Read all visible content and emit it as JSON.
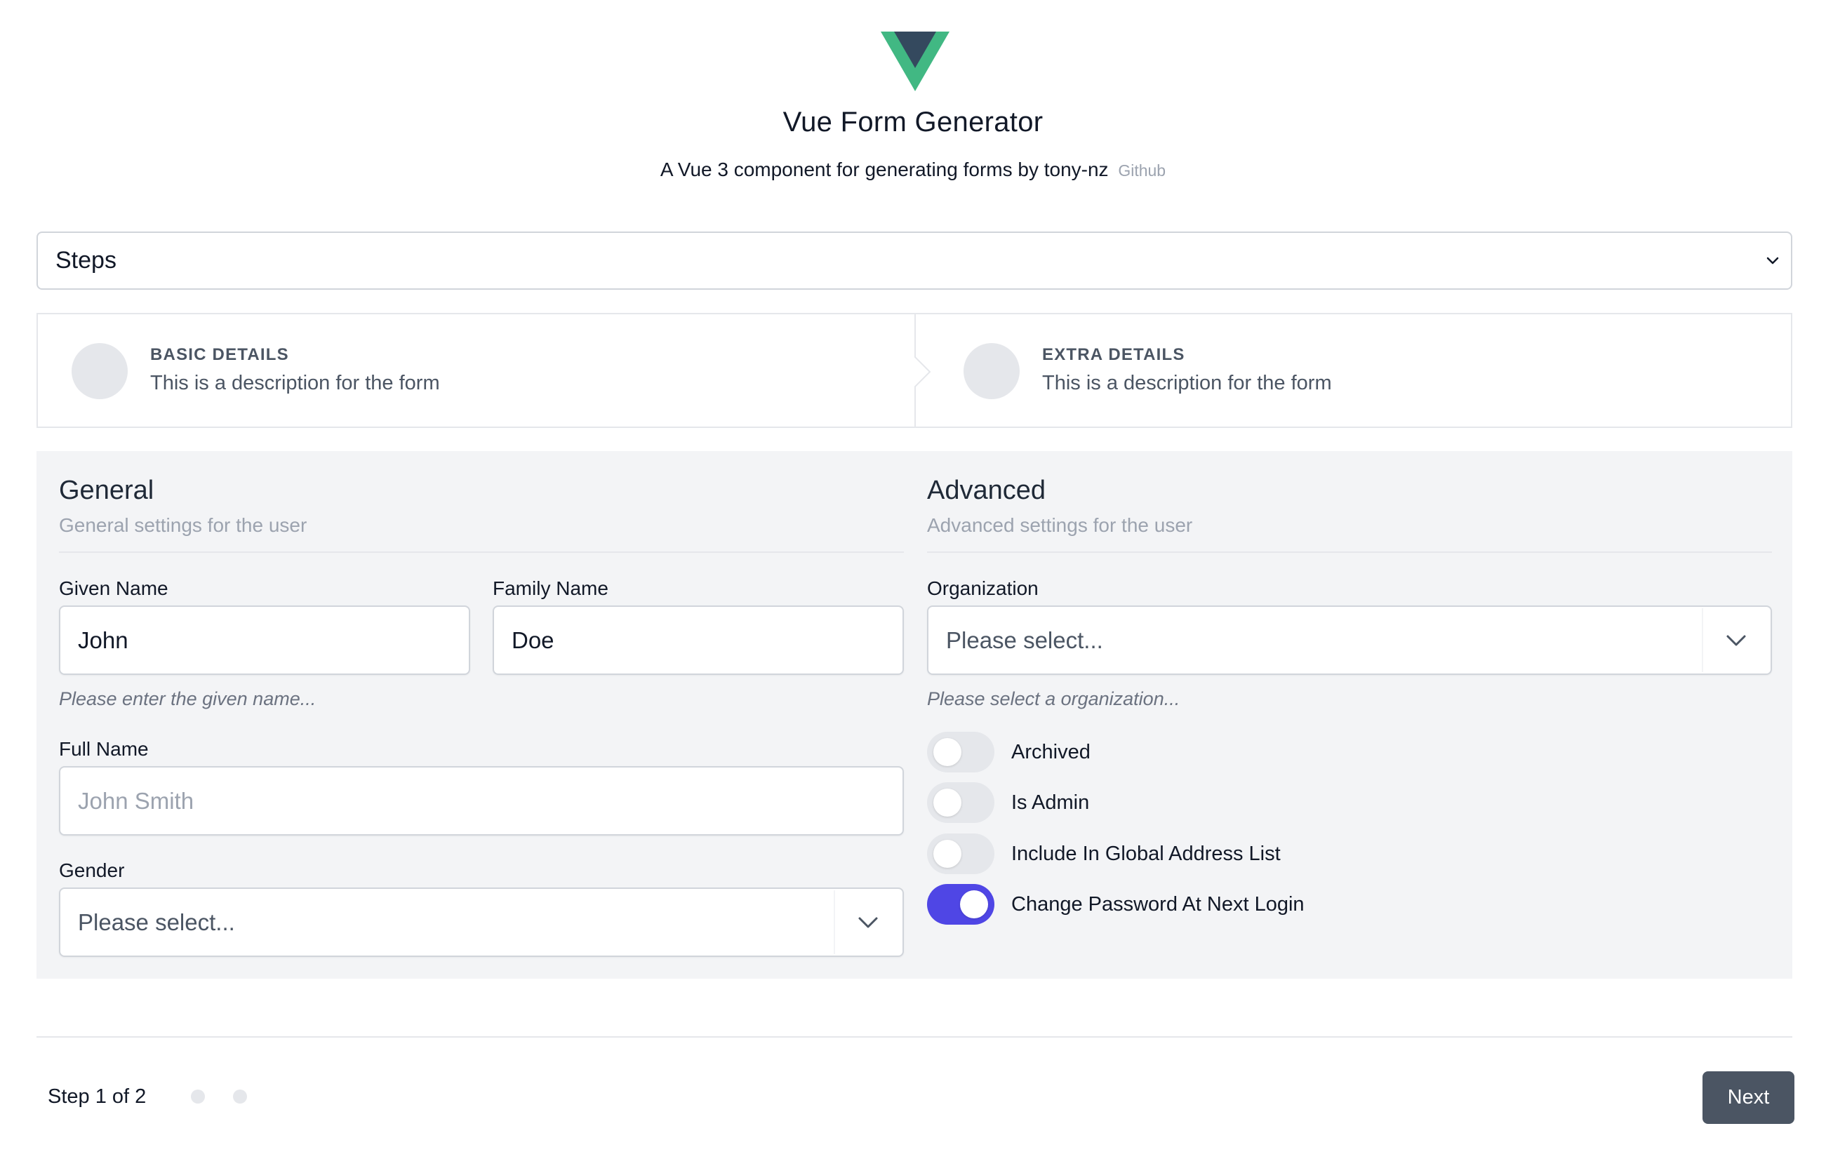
{
  "header": {
    "logo_icon": "vue-logo-icon",
    "title": "Vue Form Generator",
    "subtitle": "A Vue 3 component for generating forms by tony-nz",
    "github_link": "Github"
  },
  "example_select": {
    "value": "Steps"
  },
  "steps": [
    {
      "title": "BASIC DETAILS",
      "description": "This is a description for the form"
    },
    {
      "title": "EXTRA DETAILS",
      "description": "This is a description for the form"
    }
  ],
  "general": {
    "title": "General",
    "description": "General settings for the user",
    "given_name": {
      "label": "Given Name",
      "value": "John",
      "help": "Please enter the given name..."
    },
    "family_name": {
      "label": "Family Name",
      "value": "Doe"
    },
    "full_name": {
      "label": "Full Name",
      "placeholder": "John Smith"
    },
    "gender": {
      "label": "Gender",
      "placeholder": "Please select..."
    }
  },
  "advanced": {
    "title": "Advanced",
    "description": "Advanced settings for the user",
    "organization": {
      "label": "Organization",
      "placeholder": "Please select...",
      "help": "Please select a organization..."
    },
    "toggles": [
      {
        "label": "Archived",
        "on": false
      },
      {
        "label": "Is Admin",
        "on": false
      },
      {
        "label": "Include In Global Address List",
        "on": false
      },
      {
        "label": "Change Password At Next Login",
        "on": true
      }
    ]
  },
  "footer": {
    "step_count": "Step 1 of 2",
    "next_label": "Next"
  },
  "colors": {
    "accent": "#4f46e5",
    "panel_bg": "#f3f4f6",
    "button_bg": "#4b5563",
    "vue_green": "#41b883",
    "vue_dark": "#34495e"
  }
}
